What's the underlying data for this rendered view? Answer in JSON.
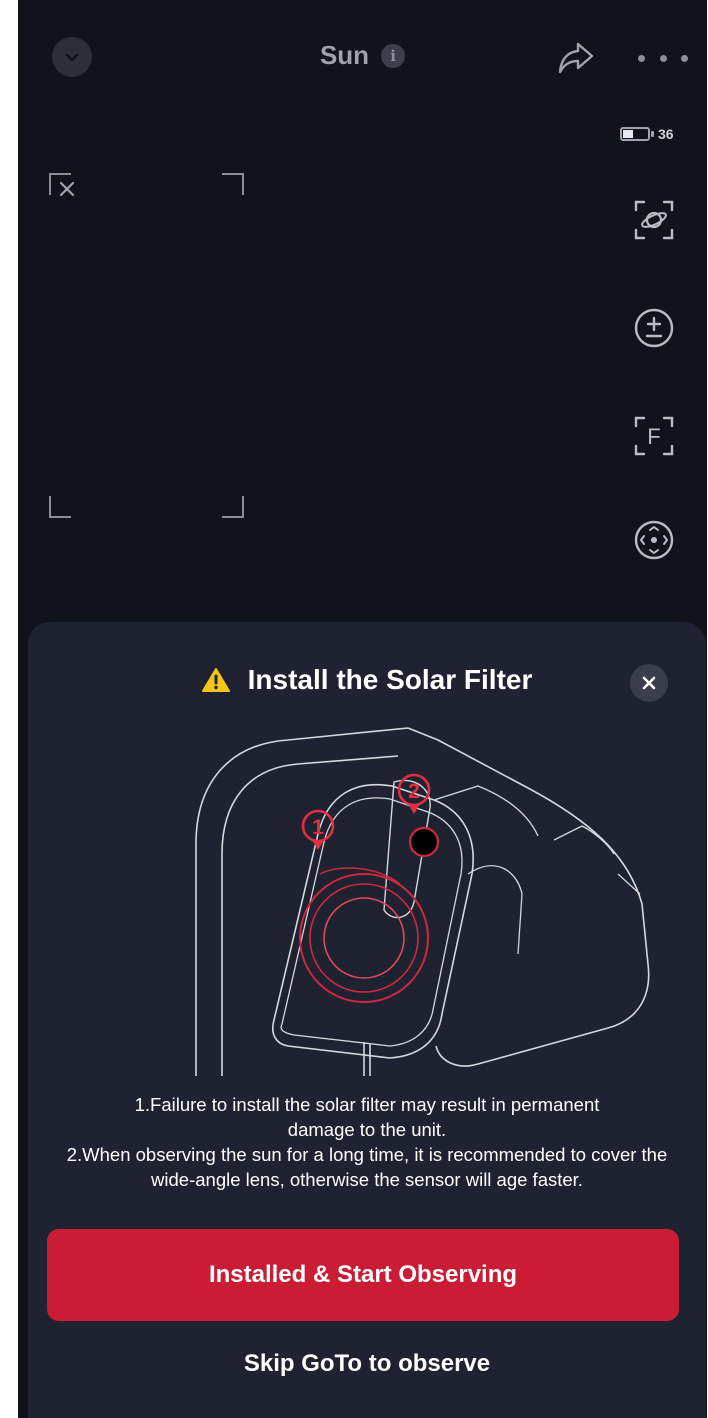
{
  "header": {
    "title": "Sun",
    "info_glyph": "i"
  },
  "status": {
    "battery_level": "36"
  },
  "side_tools": {
    "focus_label": "F"
  },
  "dialog": {
    "title": "Install the Solar Filter",
    "marker_1": "1",
    "marker_2": "2",
    "note_1": "1.Failure to install the solar filter may result in permanent damage to the unit.",
    "note_2": "2.When observing the sun for a long time, it is recommended to cover the wide-angle lens, otherwise the sensor will age faster.",
    "primary_label": "Installed & Start Observing",
    "secondary_label": "Skip GoTo to observe"
  },
  "colors": {
    "background": "#10121c",
    "sheet": "#1f2231",
    "accent_red": "#cb1c35",
    "warning_yellow": "#f5c518"
  },
  "icons": [
    "chevron-down-icon",
    "info-icon",
    "share-icon",
    "more-icon",
    "battery-icon",
    "close-x-icon",
    "planet-scan-icon",
    "exposure-icon",
    "focus-icon",
    "joystick-icon",
    "warning-icon",
    "close-icon"
  ]
}
